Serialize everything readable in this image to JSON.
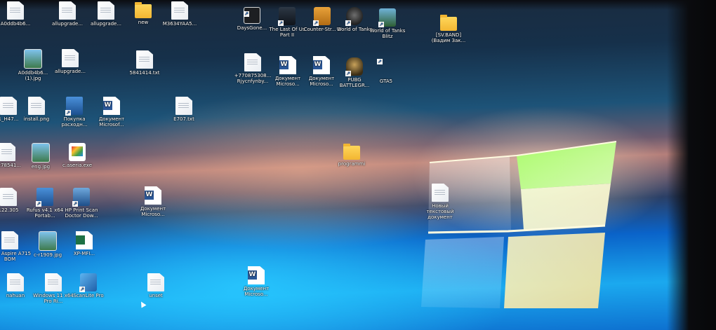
{
  "desktop": {
    "icons": [
      {
        "id": "a0ddb",
        "label": "A0ddb4b6...",
        "type": "doc"
      },
      {
        "id": "allupgrade1",
        "label": "allupgrade...",
        "type": "doc"
      },
      {
        "id": "allupgrade2",
        "label": "allupgrade...",
        "type": "doc"
      },
      {
        "id": "new",
        "label": "new",
        "type": "folder"
      },
      {
        "id": "m3634",
        "label": "M3634YAA5...",
        "type": "doc"
      },
      {
        "id": "daysgone",
        "label": "DaysGone...",
        "type": "dg"
      },
      {
        "id": "tlou",
        "label": "The Last Of Us Part II",
        "type": "tlou"
      },
      {
        "id": "cs",
        "label": "Counter-Str... 2",
        "type": "cs"
      },
      {
        "id": "wot",
        "label": "World of Tanks",
        "type": "wot"
      },
      {
        "id": "wotb",
        "label": "World of Tanks Blitz",
        "type": "wotb"
      },
      {
        "id": "svband",
        "label": "[SV.BAND] (Вадим Зак...",
        "type": "folder"
      },
      {
        "id": "a0ddb_jpg",
        "label": "A0ddb4b6... (1).jpg",
        "type": "img"
      },
      {
        "id": "allupgrade3",
        "label": "allupgrade...",
        "type": "doc"
      },
      {
        "id": "txt5841",
        "label": "5841414.txt",
        "type": "doc"
      },
      {
        "id": "phone",
        "label": "+770875308... Rjycnfynby...",
        "type": "doc"
      },
      {
        "id": "doc1",
        "label": "Документ Microso...",
        "type": "word"
      },
      {
        "id": "doc2",
        "label": "Документ Microso...",
        "type": "word"
      },
      {
        "id": "pubg",
        "label": "PUBG BATTLEGR...",
        "type": "pubg"
      },
      {
        "id": "gta5",
        "label": "GTA5",
        "type": "gta"
      },
      {
        "id": "h47",
        "label": "1_H47...",
        "type": "doc"
      },
      {
        "id": "install",
        "label": "install.png",
        "type": "doc"
      },
      {
        "id": "buy",
        "label": "Покупка расходн...",
        "type": "tool"
      },
      {
        "id": "doc3",
        "label": "Документ Microsof...",
        "type": "word"
      },
      {
        "id": "e707",
        "label": "E707.txt",
        "type": "doc"
      },
      {
        "id": "f78",
        "label": "...278541...",
        "type": "doc"
      },
      {
        "id": "eng",
        "label": "eng.jpg",
        "type": "img"
      },
      {
        "id": "casen",
        "label": "c.aseria.exe",
        "type": "paint"
      },
      {
        "id": "programs",
        "label": "programmi",
        "type": "folder"
      },
      {
        "id": "new_txt",
        "label": "Новый текстовый документ",
        "type": "doc"
      },
      {
        "id": "m122",
        "label": "122.305",
        "type": "doc"
      },
      {
        "id": "rufus",
        "label": "Rufus v4.1 x64 Portab...",
        "type": "tool"
      },
      {
        "id": "hp",
        "label": "HP Print Scan Doctor Dow...",
        "type": "hp"
      },
      {
        "id": "doc4",
        "label": "Документ Microso...",
        "type": "word"
      },
      {
        "id": "acer",
        "label": "Acer Aspire A715 BOM",
        "type": "doc"
      },
      {
        "id": "cr1909",
        "label": "c-r1909.jpg",
        "type": "img"
      },
      {
        "id": "xp",
        "label": "XP-MFI...",
        "type": "excel"
      },
      {
        "id": "nahuan",
        "label": "nahuan",
        "type": "doc"
      },
      {
        "id": "win11",
        "label": "Windows 11 x64 Pro Ri...",
        "type": "doc"
      },
      {
        "id": "scanlite",
        "label": "ScanLite Pro",
        "type": "scan"
      },
      {
        "id": "uniset",
        "label": "unset",
        "type": "doc"
      },
      {
        "id": "doc5",
        "label": "Документ Microso...",
        "type": "word"
      }
    ]
  }
}
